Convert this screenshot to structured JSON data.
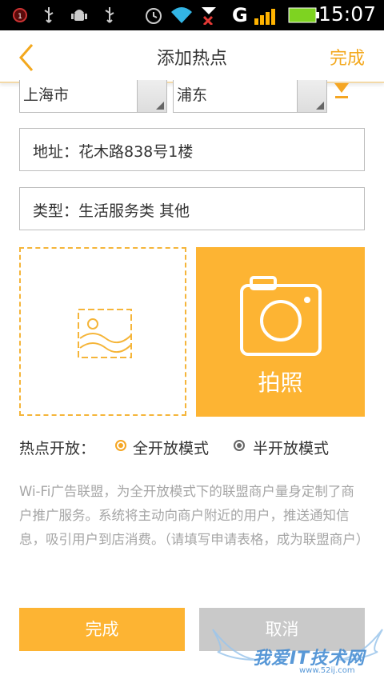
{
  "status_bar": {
    "time": "15:07",
    "network_type": "G",
    "icons": [
      "notification-icon",
      "usb-icon",
      "android-debug-icon",
      "usb-icon",
      "alarm-icon",
      "wifi-icon",
      "no-signal-icon",
      "signal-icon",
      "battery-icon"
    ]
  },
  "header": {
    "title": "添加热点",
    "done_label": "完成"
  },
  "location": {
    "city": "上海市",
    "district": "浦东"
  },
  "address": {
    "value": "地址：花木路838号1楼"
  },
  "category": {
    "value": "类型：生活服务类 其他"
  },
  "photo": {
    "camera_label": "拍照"
  },
  "hotspot_mode": {
    "label": "热点开放：",
    "options": [
      {
        "label": "全开放模式",
        "selected": true
      },
      {
        "label": "半开放模式",
        "selected": false
      }
    ]
  },
  "description": "Wi-Fi广告联盟，为全开放模式下的联盟商户量身定制了商户推广服务。系统将主动向商户附近的用户，推送通知信息，吸引用户到店消费。（请填写申请表格，成为联盟商户）",
  "actions": {
    "confirm_label": "完成",
    "cancel_label": "取消"
  },
  "watermark": {
    "text": "我爱IT技术网",
    "url": "www.52ij.com"
  },
  "colors": {
    "accent": "#fdb433",
    "accent_text": "#f3a81d",
    "disabled": "#c9c9c9"
  }
}
